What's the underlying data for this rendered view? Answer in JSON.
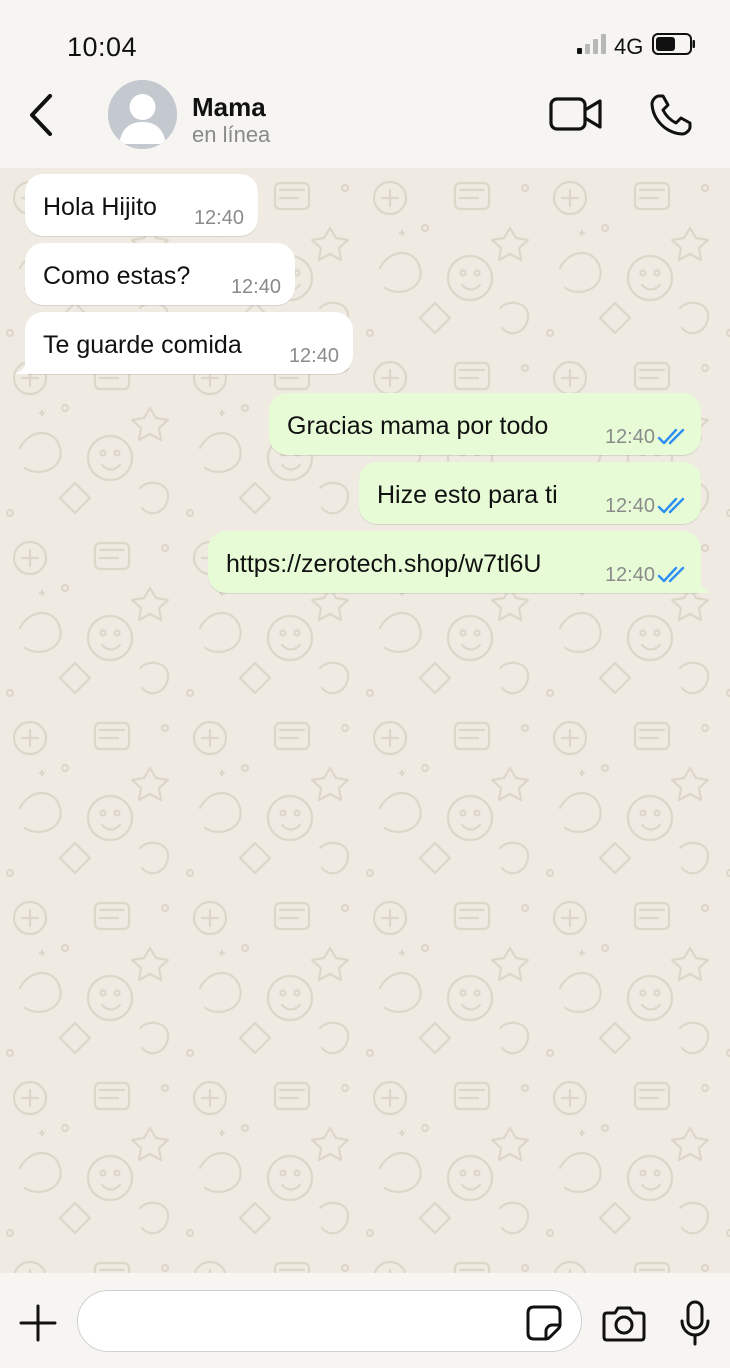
{
  "status_bar": {
    "time": "10:04",
    "network": "4G",
    "signal_icon": "signal-bars-icon",
    "battery_icon": "battery-icon"
  },
  "header": {
    "contact_name": "Mama",
    "contact_status": "en línea",
    "back_icon": "chevron-left-icon",
    "video_icon": "video-camera-icon",
    "call_icon": "phone-icon"
  },
  "messages": [
    {
      "direction": "incoming",
      "text": "Hola Hijito",
      "time": "12:40"
    },
    {
      "direction": "incoming",
      "text": "Como estas?",
      "time": "12:40"
    },
    {
      "direction": "incoming",
      "text": "Te guarde comida",
      "time": "12:40"
    },
    {
      "direction": "outgoing",
      "text": "Gracias mama por todo",
      "time": "12:40",
      "status": "read"
    },
    {
      "direction": "outgoing",
      "text": "Hize esto para ti",
      "time": "12:40",
      "status": "read"
    },
    {
      "direction": "outgoing",
      "text": "https://zerotech.shop/w7tl6U",
      "time": "12:40",
      "status": "read"
    }
  ],
  "input_bar": {
    "value": "",
    "placeholder": "",
    "plus_icon": "plus-icon",
    "sticker_icon": "sticker-icon",
    "camera_icon": "camera-icon",
    "mic_icon": "microphone-icon"
  },
  "colors": {
    "chat_background": "#efeae2",
    "incoming_bubble": "#ffffff",
    "outgoing_bubble": "#e6fbd6",
    "read_ticks": "#2b8ef0",
    "header_background": "#f6f5f2"
  }
}
